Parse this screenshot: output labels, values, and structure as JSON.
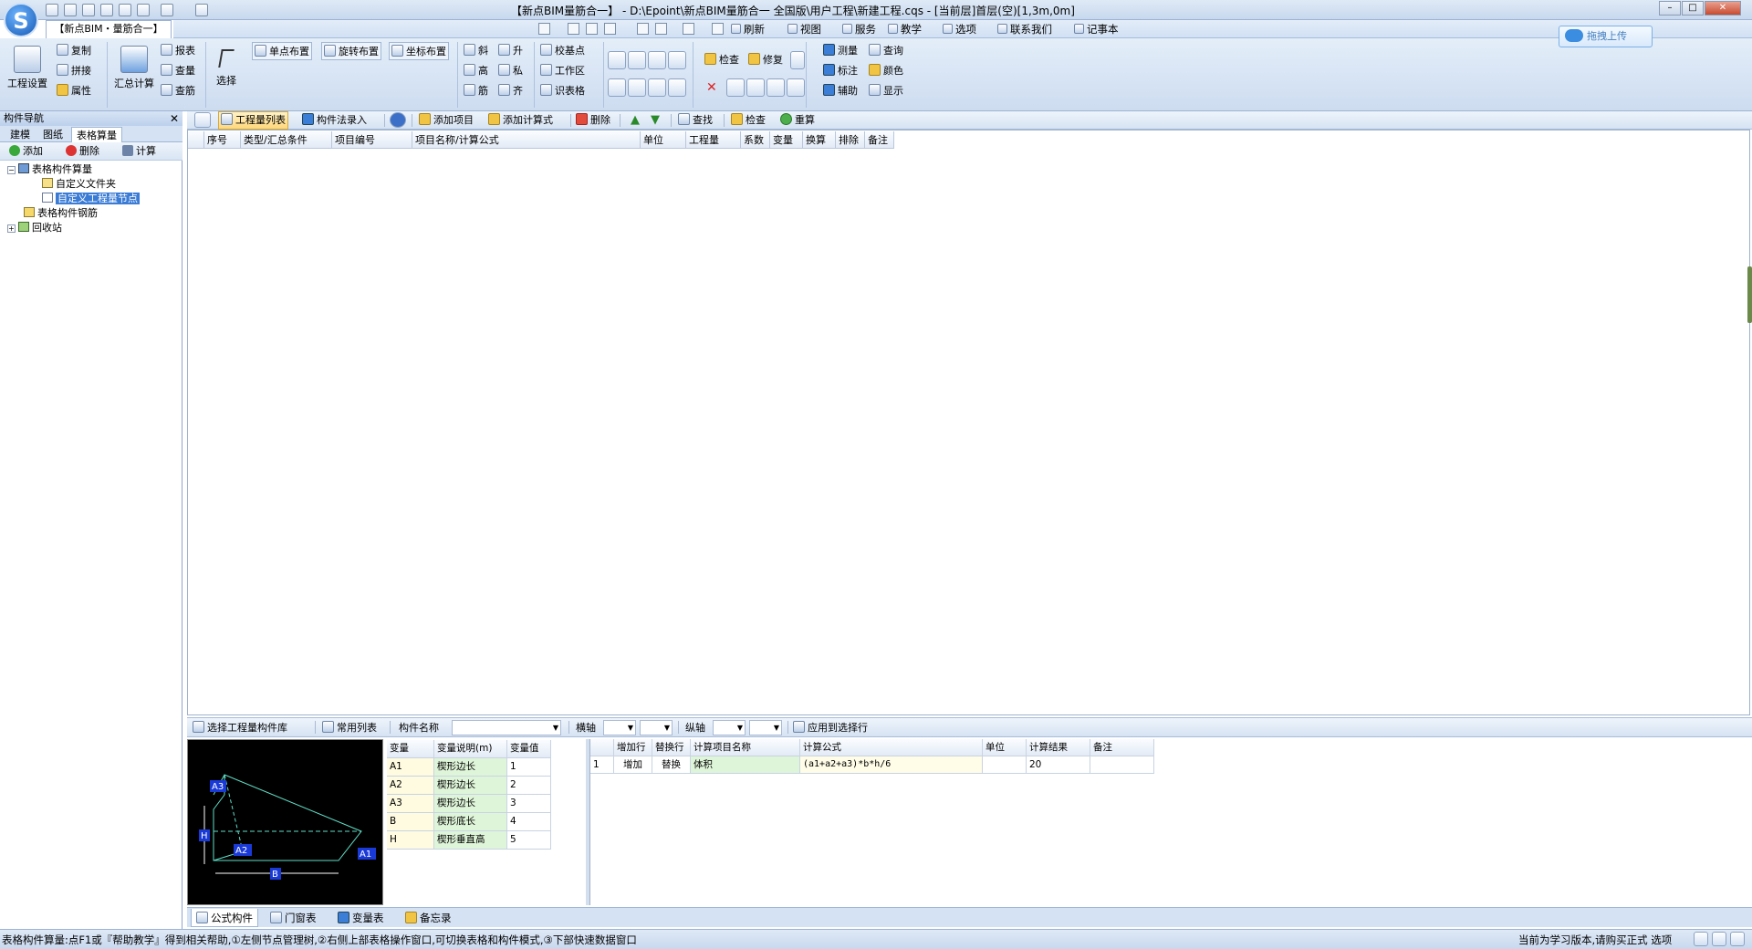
{
  "window": {
    "title": "【新点BIM量筋合一】 - D:\\Epoint\\新点BIM量筋合一 全国版\\用户工程\\新建工程.cqs - [当前层]首层(空)[1,3m,0m]",
    "app_tab": "【新点BIM・量筋合一】"
  },
  "menu": [
    {
      "label": "刷新",
      "icon": "refresh-icon"
    },
    {
      "label": "视图",
      "icon": "view-icon"
    },
    {
      "label": "服务",
      "icon": "service-icon"
    },
    {
      "label": "教学",
      "icon": "teach-icon"
    },
    {
      "label": "选项",
      "icon": "options-icon"
    },
    {
      "label": "联系我们",
      "icon": "contact-icon"
    },
    {
      "label": "记事本",
      "icon": "notepad-icon"
    }
  ],
  "upload_label": "拖拽上传",
  "ribbon": {
    "project_settings": "工程设置",
    "copy": "复制",
    "splice": "拼接",
    "properties": "属性",
    "summary_calc": "汇总计算",
    "report": "报表",
    "view_qty": "查量",
    "view_rebar": "查筋",
    "select": "选择",
    "single_place": "单点布置",
    "rotate_place": "旋转布置",
    "coord_place": "坐标布置",
    "slant": "斜",
    "raise": "升",
    "height": "高",
    "private": "私",
    "rebar": "筋",
    "align": "齐",
    "base_point": "校基点",
    "work_area": "工作区",
    "identify_table": "识表格",
    "check": "检查",
    "repair": "修复",
    "measure": "测量",
    "query": "查询",
    "annotate": "标注",
    "color": "颜色",
    "assist": "辅助",
    "display": "显示"
  },
  "nav": {
    "title": "构件导航",
    "tabs": [
      "建模",
      "图纸",
      "表格算量"
    ],
    "active_tab": 2,
    "toolbar": {
      "add": "添加",
      "delete": "删除",
      "calc": "计算"
    },
    "tree": [
      {
        "label": "表格构件算量",
        "level": 0,
        "expander": "-",
        "icon": "component-group-icon"
      },
      {
        "label": "自定义文件夹",
        "level": 1,
        "icon": "folder-icon"
      },
      {
        "label": "自定义工程量节点",
        "level": 1,
        "icon": "node-icon",
        "selected": true
      },
      {
        "label": "表格构件钢筋",
        "level": 0,
        "icon": "rebar-table-icon"
      },
      {
        "label": "回收站",
        "level": 0,
        "expander": "+",
        "icon": "recycle-bin-icon"
      }
    ]
  },
  "main_toolbar": {
    "qty_list": "工程量列表",
    "method_entry": "构件法录入",
    "add_item": "添加项目",
    "add_formula": "添加计算式",
    "delete": "删除",
    "find": "查找",
    "check": "检查",
    "recalc": "重算"
  },
  "grid_headers": [
    "序号",
    "类型/汇总条件",
    "项目编号",
    "项目名称/计算公式",
    "单位",
    "工程量",
    "系数",
    "变量",
    "换算",
    "排除",
    "备注"
  ],
  "bottom_toolbar": {
    "select_library": "选择工程量构件库",
    "common_list": "常用列表",
    "component_name": "构件名称",
    "h_axis": "横轴",
    "v_axis": "纵轴",
    "apply_to_row": "应用到选择行"
  },
  "preview": {
    "labels": [
      "A3",
      "H",
      "A2",
      "B",
      "A1"
    ]
  },
  "variables": {
    "headers": [
      "变量",
      "变量说明(m)",
      "变量值"
    ],
    "rows": [
      {
        "var": "A1",
        "desc": "楔形边长",
        "value": "1"
      },
      {
        "var": "A2",
        "desc": "楔形边长",
        "value": "2"
      },
      {
        "var": "A3",
        "desc": "楔形边长",
        "value": "3"
      },
      {
        "var": "B",
        "desc": "楔形底长",
        "value": "4"
      },
      {
        "var": "H",
        "desc": "楔形垂直高",
        "value": "5"
      }
    ]
  },
  "calc_grid": {
    "headers": [
      "",
      "增加行",
      "替换行",
      "计算项目名称",
      "计算公式",
      "单位",
      "计算结果",
      "备注"
    ],
    "rows": [
      {
        "no": "1",
        "add": "增加",
        "replace": "替换",
        "name": "体积",
        "formula": "(a1+a2+a3)*b*h/6",
        "unit": "",
        "result": "20",
        "note": ""
      }
    ]
  },
  "bottom_tabs": [
    "公式构件",
    "门窗表",
    "变量表",
    "备忘录"
  ],
  "status": {
    "left": "表格构件算量:点F1或『帮助教学』得到相关帮助,①左侧节点管理树,②右侧上部表格操作窗口,可切换表格和构件模式,③下部快速数据窗口",
    "right": "当前为学习版本,请购买正式 选项"
  }
}
